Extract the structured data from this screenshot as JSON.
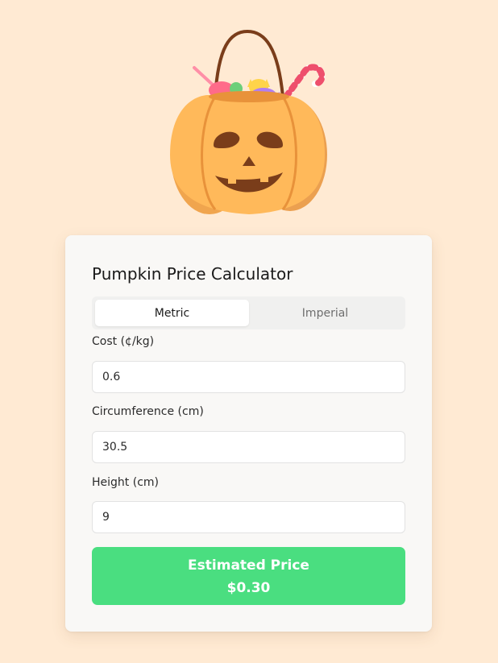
{
  "hero": {
    "icon": "pumpkin-candy-basket-icon"
  },
  "calculator": {
    "title": "Pumpkin Price Calculator",
    "tabs": [
      {
        "label": "Metric",
        "active": true
      },
      {
        "label": "Imperial",
        "active": false
      }
    ],
    "fields": {
      "cost": {
        "label": "Cost (¢/kg)",
        "value": "0.6"
      },
      "circumference": {
        "label": "Circumference (cm)",
        "value": "30.5"
      },
      "height": {
        "label": "Height (cm)",
        "value": "9"
      }
    },
    "result": {
      "label": "Estimated Price",
      "value": "$0.30"
    }
  },
  "colors": {
    "background": "#ffead3",
    "card": "#f9f8f6",
    "accent_green": "#4ade80",
    "pumpkin": "#ffb95a"
  }
}
